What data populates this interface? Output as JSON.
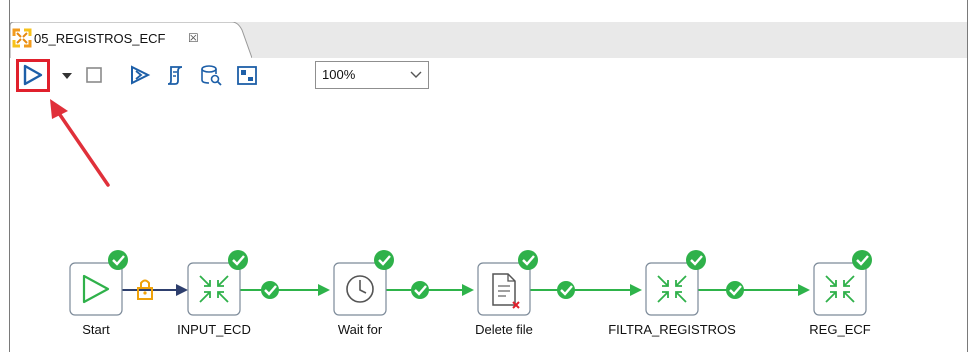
{
  "editor": {
    "tab": {
      "label": "05_REGISTROS_ECF",
      "close_glyph": "☒",
      "icon": "job-icon"
    },
    "toolbar": {
      "run_icon": "play-icon",
      "run_dropdown_icon": "chevron-down-icon",
      "stop_icon": "stop-icon",
      "preview_icon": "preview-run-icon",
      "script_icon": "script-icon",
      "database_icon": "database-search-icon",
      "grid_icon": "grid-icon",
      "zoom": {
        "value": "100%",
        "icon": "chevron-down-icon"
      },
      "highlight_color": "#e0202c"
    },
    "workflow": {
      "accent_green": "#2fb14a",
      "hop_color": "#2eb34a",
      "nodes": [
        {
          "id": "start",
          "label": "Start",
          "icon": "play-icon",
          "status": "success"
        },
        {
          "id": "input_ecd",
          "label": "INPUT_ECD",
          "icon": "transformation-icon",
          "status": "success"
        },
        {
          "id": "wait_for",
          "label": "Wait for",
          "icon": "clock-icon",
          "status": "success"
        },
        {
          "id": "delete_file",
          "label": "Delete file",
          "icon": "delete-file-icon",
          "status": "success"
        },
        {
          "id": "filtra_registros",
          "label": "FILTRA_REGISTROS",
          "icon": "transformation-icon",
          "status": "success"
        },
        {
          "id": "reg_ecf",
          "label": "REG_ECF",
          "icon": "transformation-icon",
          "status": "success"
        }
      ]
    }
  }
}
